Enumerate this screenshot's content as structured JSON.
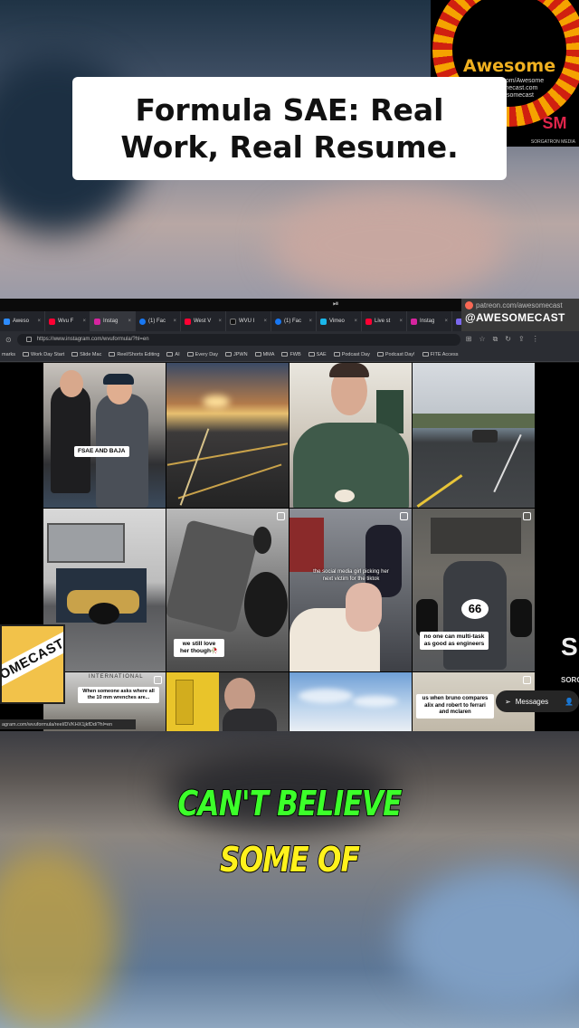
{
  "title_card": {
    "text": "Formula SAE: Real Work, Real Resume."
  },
  "logo": {
    "word": "Awesome",
    "sub_lines": [
      "Patreon.com/Awesome",
      "Awesomecast.com",
      "@awesomecast"
    ],
    "sm": "SM",
    "sm_caption": "SORGATRON MEDIA"
  },
  "watermark": {
    "patreon_url": "patreon.com/awesomecast",
    "handle": "@AWESOMECAST"
  },
  "browser": {
    "tabs": [
      {
        "label": "Aweso",
        "color": "#2d8cff"
      },
      {
        "label": "Wvu F",
        "color": "#ff0033"
      },
      {
        "label": "Instag",
        "color": "#d6249f",
        "active": true
      },
      {
        "label": "(1) Fac",
        "color": "#1877f2"
      },
      {
        "label": "West V",
        "color": "#ff0033"
      },
      {
        "label": "WVU I",
        "color": "#111111"
      },
      {
        "label": "(1) Fac",
        "color": "#1877f2"
      },
      {
        "label": "Vimeo",
        "color": "#1ab7ea"
      },
      {
        "label": "Live st",
        "color": "#ff0033"
      },
      {
        "label": "Instag",
        "color": "#d6249f"
      },
      {
        "label": "(1",
        "color": "#7b68ee"
      }
    ],
    "url": "https://www.instagram.com/wvuformula/?hl=en",
    "bookmarks": [
      "marks",
      "Work Day Start",
      "Slide Mac",
      "Reel/Shorts Editing",
      "AI",
      "Every Day",
      "JPWN",
      "MMA",
      "FWB",
      "SAE",
      "Podcast Day",
      "Podcast Day!",
      "FITE Access"
    ],
    "status_url": "agram.com/wvuformula/reel/DVKHX1jkfDd/?hl=en"
  },
  "grid": {
    "captions": {
      "fsae_baja": "FSAE AND BAJA",
      "still_love": "we still love her though🥀",
      "social_media_girl": "the social media girl picking her next victim for the tiktok",
      "multitask": "no one can multi-task as good as engineers",
      "wrenches": "When someone asks where all the 10 mm wrenches are...",
      "international": "INTERNATIONAL",
      "bruno": "us when bruno compares alix and robert to ferrari and mclaren",
      "car_number": "66"
    }
  },
  "sticker": {
    "text": "OMECAST"
  },
  "side": {
    "letter": "S",
    "text": "SORG"
  },
  "messages": {
    "label": "Messages"
  },
  "subtitles": {
    "line1": "CAN'T BELIEVE",
    "line2": "SOME OF"
  }
}
